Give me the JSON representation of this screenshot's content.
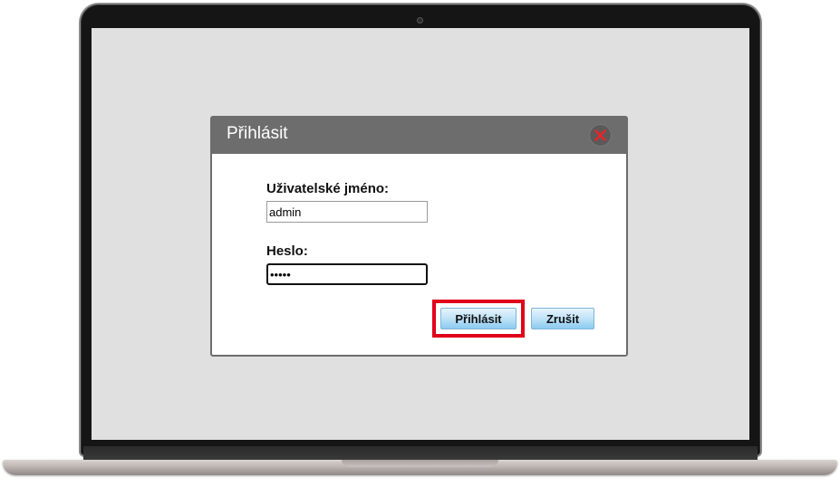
{
  "dialog": {
    "title": "Přihlásit",
    "close_icon": "close-icon",
    "username_label": "Uživatelské jméno:",
    "username_value": "admin",
    "password_label": "Heslo:",
    "password_value": "•••••",
    "login_label": "Přihlásit",
    "cancel_label": "Zrušit",
    "highlight_color": "#e0001a",
    "header_color": "#6d6d6d"
  }
}
